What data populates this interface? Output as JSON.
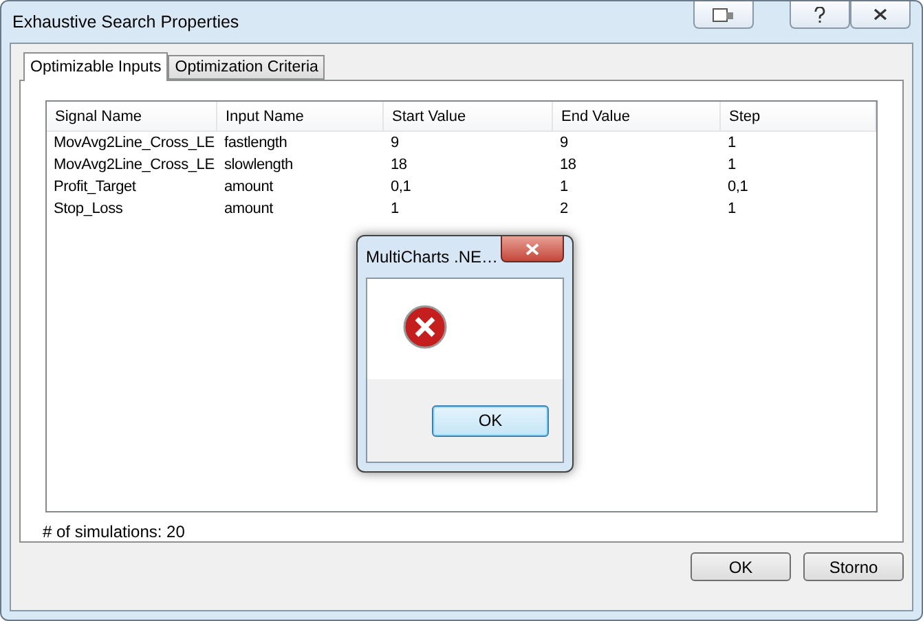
{
  "window": {
    "title": "Exhaustive Search Properties"
  },
  "tabs": [
    {
      "label": "Optimizable Inputs",
      "selected": true
    },
    {
      "label": "Optimization Criteria",
      "selected": false
    }
  ],
  "table": {
    "columns": [
      "Signal Name",
      "Input Name",
      "Start Value",
      "End Value",
      "Step"
    ],
    "rows": [
      [
        "MovAvg2Line_Cross_LE",
        "fastlength",
        "9",
        "9",
        "1"
      ],
      [
        "MovAvg2Line_Cross_LE",
        "slowlength",
        "18",
        "18",
        "1"
      ],
      [
        "Profit_Target",
        "amount",
        "0,1",
        "1",
        "0,1"
      ],
      [
        "Stop_Loss",
        "amount",
        "1",
        "2",
        "1"
      ]
    ]
  },
  "simulations": "# of simulations: 20",
  "buttons": [
    "OK",
    "Storno"
  ],
  "message_box": {
    "title": "MultiCharts .NE…",
    "button": "OK"
  }
}
